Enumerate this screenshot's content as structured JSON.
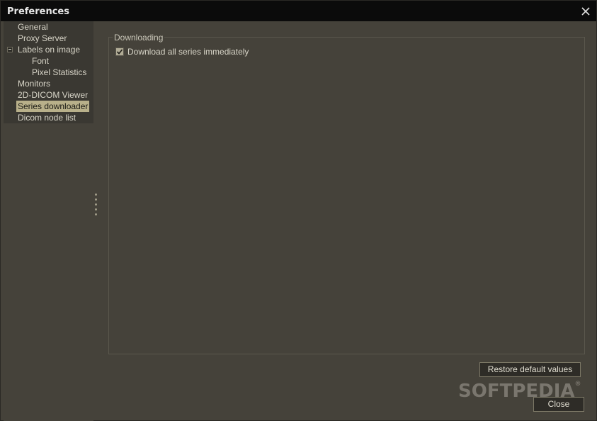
{
  "window": {
    "title": "Preferences"
  },
  "tree": {
    "items": [
      {
        "label": "General"
      },
      {
        "label": "Proxy Server"
      },
      {
        "label": "Labels on image"
      },
      {
        "label": "Font"
      },
      {
        "label": "Pixel Statistics"
      },
      {
        "label": "Monitors"
      },
      {
        "label": "2D-DICOM Viewer"
      },
      {
        "label": "Series downloader"
      },
      {
        "label": "Dicom node list"
      }
    ],
    "selected": "Series downloader",
    "expanded": "Labels on image"
  },
  "panel": {
    "group_title": "Downloading",
    "checkbox_label": "Download all series immediately",
    "checkbox_checked": true
  },
  "buttons": {
    "restore_label": "Restore default values",
    "close_label": "Close"
  },
  "watermark": {
    "text": "SOFTPEDIA",
    "mark": "®"
  },
  "colors": {
    "titlebar": "#0b0b0b",
    "background": "#45423a",
    "selection": "#b8b08a"
  }
}
